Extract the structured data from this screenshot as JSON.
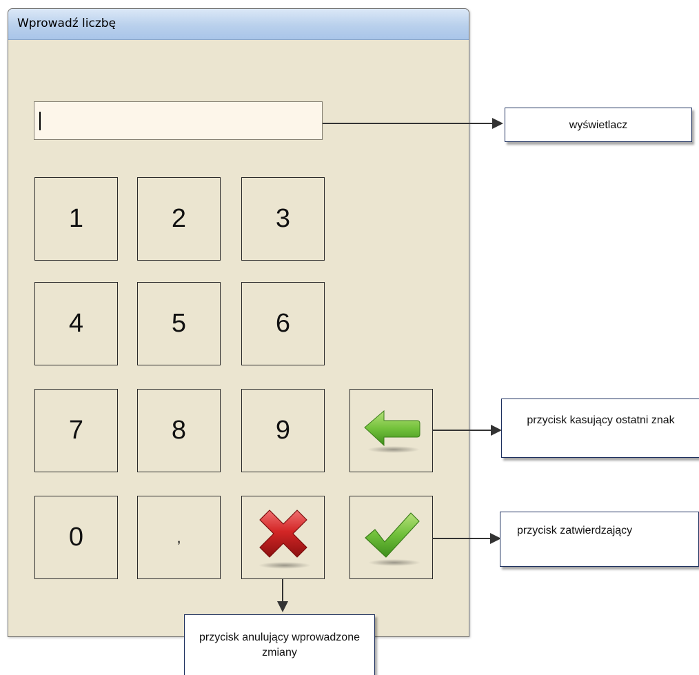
{
  "window": {
    "title": "Wprowadź liczbę",
    "display_value": ""
  },
  "keypad": {
    "keys": [
      "1",
      "2",
      "3",
      "4",
      "5",
      "6",
      "7",
      "8",
      "9",
      "0",
      ","
    ],
    "backspace_icon": "green-left-arrow-icon",
    "cancel_icon": "red-x-icon",
    "confirm_icon": "green-checkmark-icon"
  },
  "callouts": {
    "display": "wyświetlacz",
    "backspace": "przycisk kasujący ostatni znak",
    "confirm": "przycisk zatwierdzający",
    "cancel": "przycisk anulujący wprowadzone zmiany"
  },
  "colors": {
    "window_bg": "#ebe5d0",
    "titlebar": "#b9d0ec",
    "display_bg": "#fdf6ea",
    "callout_border": "#1c2f5e",
    "green": "#6fbf3a",
    "red": "#d32626"
  }
}
